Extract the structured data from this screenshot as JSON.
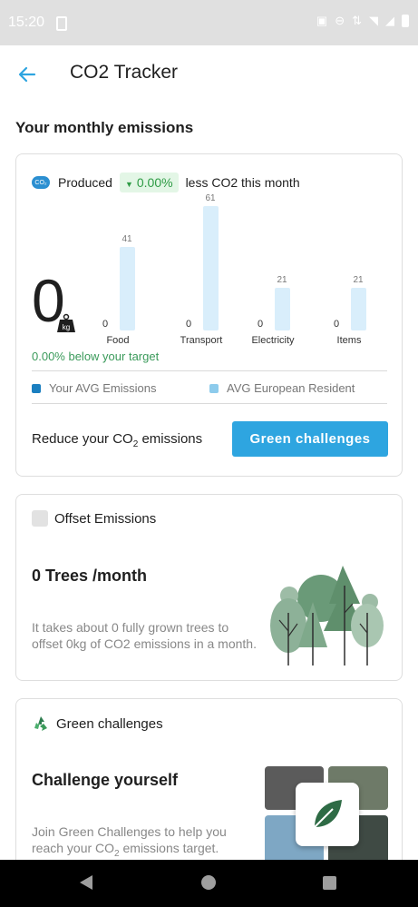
{
  "status_bar": {
    "time": "15:20",
    "icons": [
      "screenshot-icon",
      "dnd-icon",
      "signal-icon",
      "wifi-icon",
      "signal-bars-icon",
      "battery-icon"
    ]
  },
  "header": {
    "title": "CO2 Tracker",
    "back_icon": "arrow-left-icon"
  },
  "monthly": {
    "section_title": "Your monthly emissions",
    "produced_label": "Produced",
    "change_value": "0.00%",
    "change_suffix": "less CO2 this month",
    "total_value": "0",
    "unit": "kg",
    "target_text": "0.00% below your target",
    "legend_yours": "Your AVG Emissions",
    "legend_european": "AVG European Resident",
    "reduce_text_pre": "Reduce your CO",
    "reduce_text_sub": "2",
    "reduce_text_post": " emissions",
    "button_label": "Green challenges",
    "colors": {
      "yours": "#1b7fc0",
      "european": "#8dcbec",
      "bar": "#d9eefb",
      "accent": "#2ea5e0",
      "positive": "#2e9b45"
    }
  },
  "chart_data": {
    "type": "bar",
    "categories": [
      "Food",
      "Transport",
      "Electricity",
      "Items"
    ],
    "series": [
      {
        "name": "Your AVG Emissions",
        "values": [
          0,
          0,
          0,
          0
        ]
      },
      {
        "name": "AVG European Resident",
        "values": [
          41,
          61,
          21,
          21
        ]
      }
    ],
    "ylim": [
      0,
      61
    ]
  },
  "offset": {
    "header_label": "Offset Emissions",
    "title": "0 Trees /month",
    "description": "It takes about 0 fully grown trees to offset 0kg of CO2 emissions in a month."
  },
  "challenges": {
    "header_label": "Green challenges",
    "title": "Challenge yourself",
    "description_pre": "Join Green Challenges to help you reach your CO",
    "description_sub": "2",
    "description_post": " emissions target."
  },
  "nav_bar": {
    "icons": [
      "back-triangle-icon",
      "home-circle-icon",
      "recents-square-icon"
    ]
  }
}
